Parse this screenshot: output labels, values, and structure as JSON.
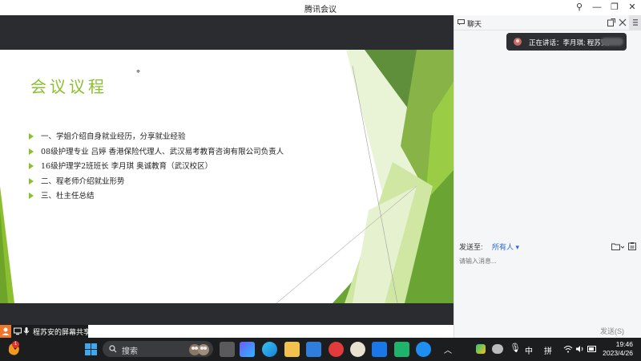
{
  "window": {
    "title": "腾讯会议"
  },
  "slide": {
    "title": "会议议程",
    "agenda": [
      "一、学姐介绍自身就业经历，分享就业经验",
      "08级护理专业  吕婷  香港保险代理人、武汉易考教育咨询有限公司负责人",
      "16级护理学2班班长  李月琪 奥诚教育（武汉校区）",
      "二、程老师介绍就业形势",
      "三、杜主任总结"
    ],
    "accent_color": "#8cbf2f"
  },
  "share_bar": {
    "text": "程苏安的屏幕共享"
  },
  "chat": {
    "title": "聊天",
    "speaking_label": "正在讲话：李月琪; 程苏安;",
    "send_to_label": "发送至:",
    "send_target": "所有人",
    "input_placeholder": "请输入消息...",
    "send_button": "发送(S)"
  },
  "taskbar": {
    "search_label": "搜索",
    "ime_lang": "中",
    "ime_mode": "拼",
    "time": "19:46",
    "date": "2023/4/26",
    "notification_count": "1"
  }
}
